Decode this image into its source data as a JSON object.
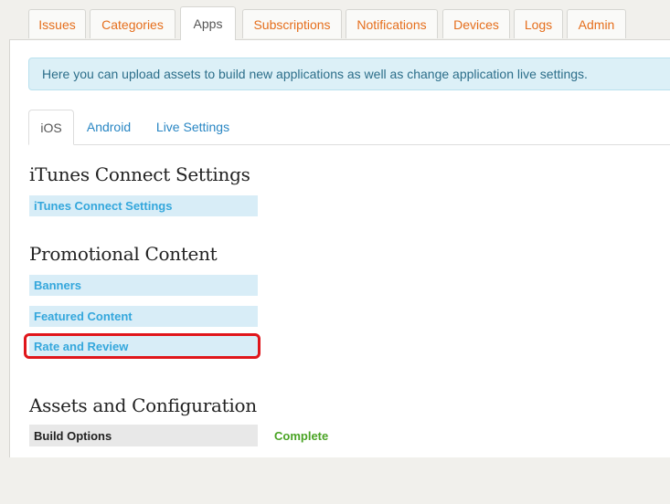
{
  "top_tabs": [
    {
      "label": "Issues"
    },
    {
      "label": "Categories"
    },
    {
      "label": "Apps"
    },
    {
      "label": "Subscriptions"
    },
    {
      "label": "Notifications"
    },
    {
      "label": "Devices"
    },
    {
      "label": "Logs"
    },
    {
      "label": "Admin"
    }
  ],
  "info_message": "Here you can upload assets to build new applications as well as change application live settings.",
  "sub_tabs": [
    {
      "label": "iOS"
    },
    {
      "label": "Android"
    },
    {
      "label": "Live Settings"
    }
  ],
  "sections": {
    "itunes": {
      "title": "iTunes Connect Settings",
      "links": [
        "iTunes Connect Settings"
      ]
    },
    "promo": {
      "title": "Promotional Content",
      "links": [
        "Banners",
        "Featured Content",
        "Rate and Review"
      ]
    },
    "assets": {
      "title": "Assets and Configuration",
      "build_label": "Build Options",
      "build_status": "Complete"
    }
  },
  "colors": {
    "tab_text": "#e56e1c",
    "link_text": "#34a7dc",
    "status_complete": "#4aa425",
    "highlight": "#e0161b"
  }
}
